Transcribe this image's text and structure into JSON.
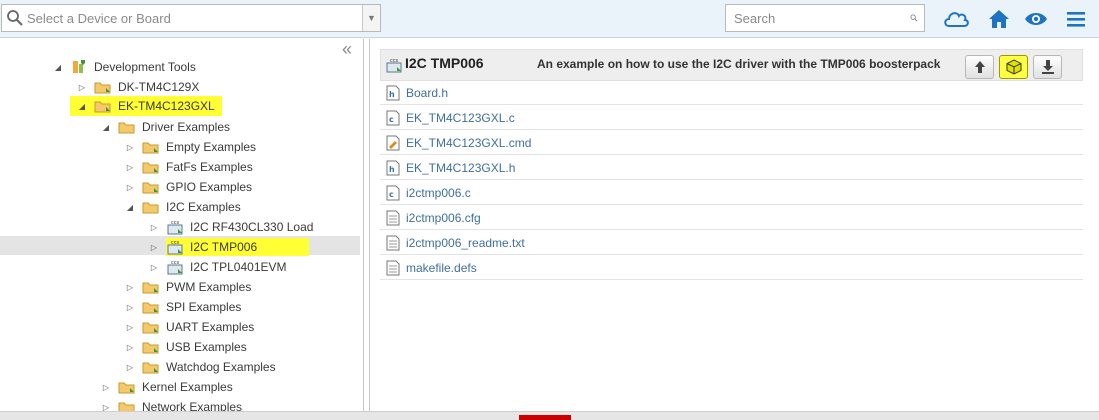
{
  "toolbar": {
    "device_placeholder": "Select a Device or Board",
    "search_placeholder": "Search",
    "accent_color": "#1d74c2"
  },
  "tree": {
    "collapse_symbol": "«",
    "items": [
      {
        "label": "Development Tools",
        "icon": "board-icon",
        "state": "expanded"
      },
      {
        "label": "DK-TM4C129X",
        "icon": "folder-icon",
        "state": "collapsed"
      },
      {
        "label": "EK-TM4C123GXL",
        "icon": "folder-icon",
        "state": "expanded",
        "highlighted": true
      },
      {
        "label": "Driver Examples",
        "icon": "folder-icon",
        "state": "expanded"
      },
      {
        "label": "Empty Examples",
        "icon": "folder-icon",
        "state": "collapsed"
      },
      {
        "label": "FatFs Examples",
        "icon": "folder-icon",
        "state": "collapsed"
      },
      {
        "label": "GPIO Examples",
        "icon": "folder-icon",
        "state": "collapsed"
      },
      {
        "label": "I2C Examples",
        "icon": "folder-icon",
        "state": "expanded"
      },
      {
        "label": "I2C RF430CL330 Load",
        "icon": "ccs-project-icon",
        "state": "collapsed"
      },
      {
        "label": "I2C TMP006",
        "icon": "ccs-project-icon",
        "state": "collapsed",
        "selected": true,
        "highlighted": true
      },
      {
        "label": "I2C TPL0401EVM",
        "icon": "ccs-project-icon",
        "state": "collapsed"
      },
      {
        "label": "PWM Examples",
        "icon": "folder-icon",
        "state": "collapsed"
      },
      {
        "label": "SPI Examples",
        "icon": "folder-icon",
        "state": "collapsed"
      },
      {
        "label": "UART Examples",
        "icon": "folder-icon",
        "state": "collapsed"
      },
      {
        "label": "USB Examples",
        "icon": "folder-icon",
        "state": "collapsed"
      },
      {
        "label": "Watchdog Examples",
        "icon": "folder-icon",
        "state": "collapsed"
      },
      {
        "label": "Kernel Examples",
        "icon": "folder-icon",
        "state": "collapsed"
      },
      {
        "label": "Network Examples",
        "icon": "folder-icon",
        "state": "collapsed"
      }
    ]
  },
  "detail": {
    "title": "I2C TMP006",
    "description": "An example on how to use the I2C driver with the TMP006 boosterpack",
    "files": [
      {
        "name": "Board.h",
        "icon": "header-file-icon"
      },
      {
        "name": "EK_TM4C123GXL.c",
        "icon": "c-file-icon"
      },
      {
        "name": "EK_TM4C123GXL.cmd",
        "icon": "cmd-file-icon"
      },
      {
        "name": "EK_TM4C123GXL.h",
        "icon": "header-file-icon"
      },
      {
        "name": "i2ctmp006.c",
        "icon": "c-file-icon"
      },
      {
        "name": "i2ctmp006.cfg",
        "icon": "text-file-icon"
      },
      {
        "name": "i2ctmp006_readme.txt",
        "icon": "text-file-icon"
      },
      {
        "name": "makefile.defs",
        "icon": "text-file-icon"
      }
    ]
  }
}
